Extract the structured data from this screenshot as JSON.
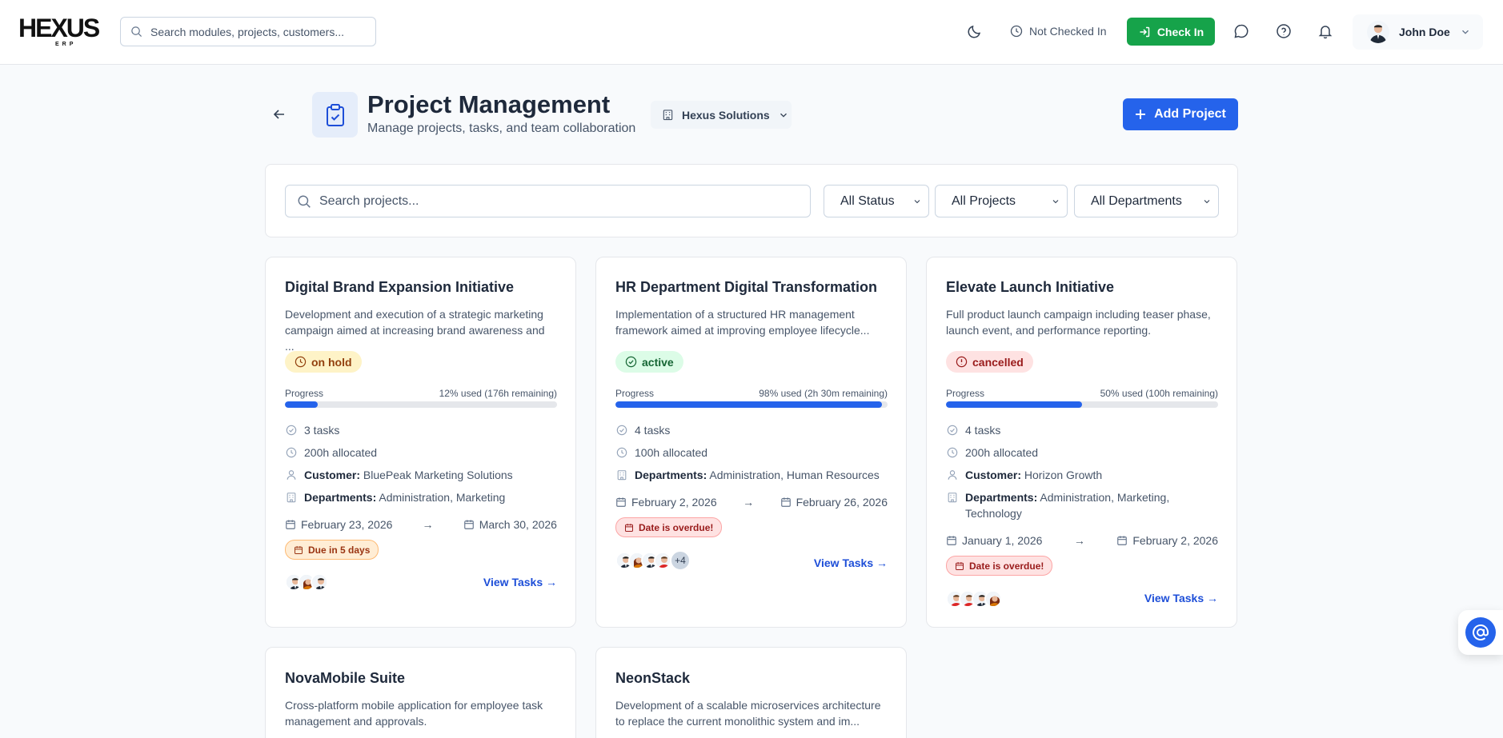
{
  "topbar": {
    "logo_text": "HEXUS",
    "logo_sub": "ERP",
    "search_placeholder": "Search modules, projects, customers...",
    "checkin_status": "Not Checked In",
    "checkin_label": "Check In",
    "user_name": "John Doe",
    "icons": [
      "moon-icon",
      "clock-icon",
      "chat-icon",
      "help-icon",
      "bell-icon",
      "chevron-down-icon"
    ]
  },
  "header": {
    "title": "Project Management",
    "subtitle": "Manage projects, tasks, and team collaboration",
    "company": "Hexus Solutions",
    "add_label": "Add Project"
  },
  "filters": {
    "search_placeholder": "Search projects...",
    "status": "All Status",
    "projects": "All Projects",
    "departments": "All Departments"
  },
  "labels": {
    "progress": "Progress",
    "customer": "Customer:",
    "departments": "Departments:",
    "view_tasks": "View Tasks →",
    "arrow": "→"
  },
  "projects": [
    {
      "title": "Digital Brand Expansion Initiative",
      "description": "Development and execution of a strategic marketing campaign aimed at increasing brand awareness and ...",
      "status": "on hold",
      "progress_fraction": 0.12,
      "progress_text": "12% used (176h remaining)",
      "tasks": "3 tasks",
      "allocated": "200h allocated",
      "customer": "BluePeak Marketing Solutions",
      "departments": "Administration, Marketing",
      "start_date": "February 23, 2026",
      "end_date": "March 30, 2026",
      "date_badge": "Due in 5 days"
    },
    {
      "title": "HR Department Digital Transformation",
      "description": "Implementation of a structured HR management framework aimed at improving employee lifecycle...",
      "status": "active",
      "progress_fraction": 0.98,
      "progress_text": "98% used (2h 30m remaining)",
      "tasks": "4 tasks",
      "allocated": "100h allocated",
      "departments": "Administration, Human Resources",
      "start_date": "February 2, 2026",
      "end_date": "February 26, 2026",
      "date_badge": "Date is overdue!",
      "extra_members": "+4"
    },
    {
      "title": "Elevate Launch Initiative",
      "description": "Full product launch campaign including teaser phase, launch event, and performance reporting.",
      "status": "cancelled",
      "progress_fraction": 0.5,
      "progress_text": "50% used (100h remaining)",
      "tasks": "4 tasks",
      "allocated": "200h allocated",
      "customer": "Horizon Growth",
      "departments": "Administration, Marketing, Technology",
      "start_date": "January 1, 2026",
      "end_date": "February 2, 2026",
      "date_badge": "Date is overdue!"
    },
    {
      "title": "NovaMobile Suite",
      "description": "Cross-platform mobile application for employee task management and approvals."
    },
    {
      "title": "NeonStack",
      "description": "Development of a scalable microservices architecture to replace the current monolithic system and im..."
    }
  ],
  "colors": {
    "primary": "#2563eb",
    "success": "#16a34a",
    "onhold_bg": "#fef3c7",
    "active_bg": "#dcfce7",
    "cancelled_bg": "#fee2e2"
  }
}
